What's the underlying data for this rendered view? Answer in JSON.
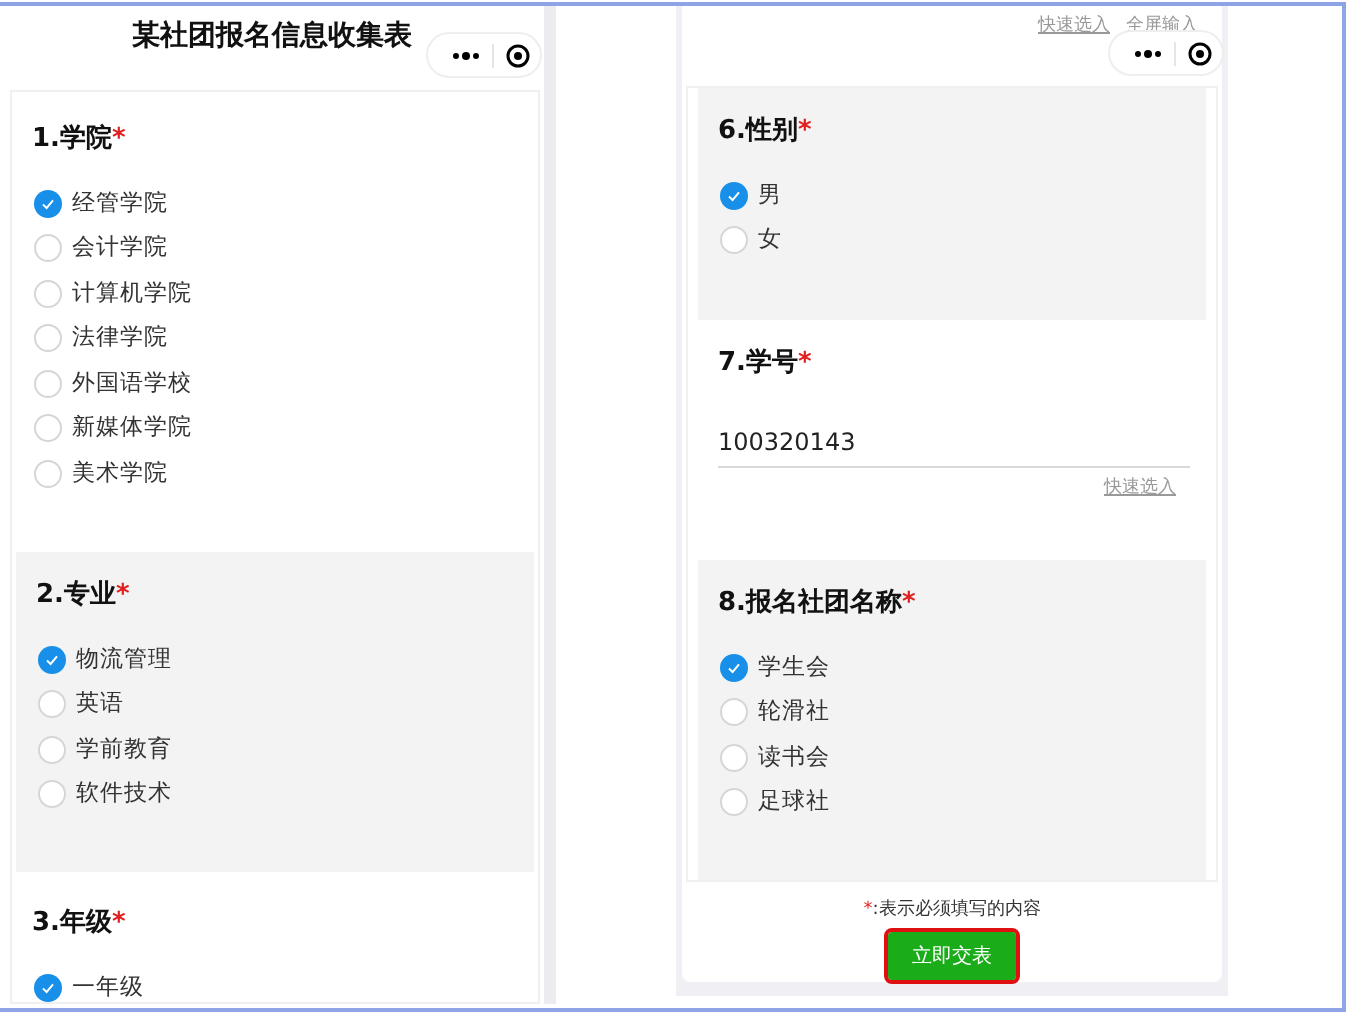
{
  "left_screen": {
    "title": "某社团报名信息收集表",
    "questions": [
      {
        "kind": "choice",
        "title": "1.学院",
        "required": true,
        "shaded": false,
        "options": [
          {
            "label": "经管学院",
            "selected": true
          },
          {
            "label": "会计学院",
            "selected": false
          },
          {
            "label": "计算机学院",
            "selected": false
          },
          {
            "label": "法律学院",
            "selected": false
          },
          {
            "label": "外国语学校",
            "selected": false
          },
          {
            "label": "新媒体学院",
            "selected": false
          },
          {
            "label": "美术学院",
            "selected": false
          }
        ]
      },
      {
        "kind": "choice",
        "title": "2.专业",
        "required": true,
        "shaded": true,
        "options": [
          {
            "label": "物流管理",
            "selected": true
          },
          {
            "label": "英语",
            "selected": false
          },
          {
            "label": "学前教育",
            "selected": false
          },
          {
            "label": "软件技术",
            "selected": false
          }
        ]
      },
      {
        "kind": "choice",
        "title": "3.年级",
        "required": true,
        "shaded": false,
        "options": [
          {
            "label": "一年级",
            "selected": true
          }
        ]
      }
    ]
  },
  "right_screen": {
    "top_links": [
      "快速选入",
      "全屏输入"
    ],
    "questions": [
      {
        "kind": "choice",
        "title": "6.性别",
        "required": true,
        "shaded": true,
        "options": [
          {
            "label": "男",
            "selected": true
          },
          {
            "label": "女",
            "selected": false
          }
        ]
      },
      {
        "kind": "text",
        "title": "7.学号",
        "required": true,
        "shaded": false,
        "value": "100320143",
        "link": "快速选入"
      },
      {
        "kind": "choice",
        "title": "8.报名社团名称",
        "required": true,
        "shaded": true,
        "options": [
          {
            "label": "学生会",
            "selected": true
          },
          {
            "label": "轮滑社",
            "selected": false
          },
          {
            "label": "读书会",
            "selected": false
          },
          {
            "label": "足球社",
            "selected": false
          }
        ]
      }
    ],
    "required_note": {
      "mark": "*",
      "text": ":表示必须填写的内容"
    },
    "submit_button": "立即交表"
  }
}
